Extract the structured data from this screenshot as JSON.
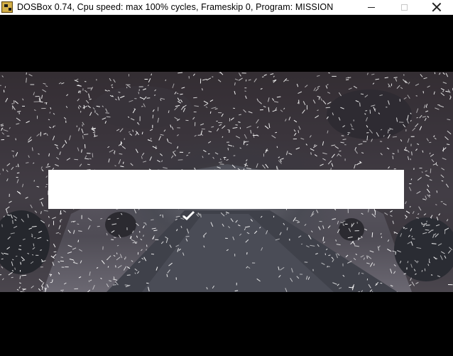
{
  "window": {
    "title": "DOSBox 0.74, Cpu speed: max 100% cycles, Frameskip  0, Program:  MISSION",
    "app_icon": "dosbox-icon",
    "controls": {
      "minimize_icon": "minimize-icon",
      "maximize_icon": "maximize-icon",
      "close_icon": "close-icon"
    }
  },
  "game": {
    "scene": "cave-tunnel",
    "banner_color": "#ffffff",
    "cursor_icon": "checkmark-cursor-icon"
  }
}
